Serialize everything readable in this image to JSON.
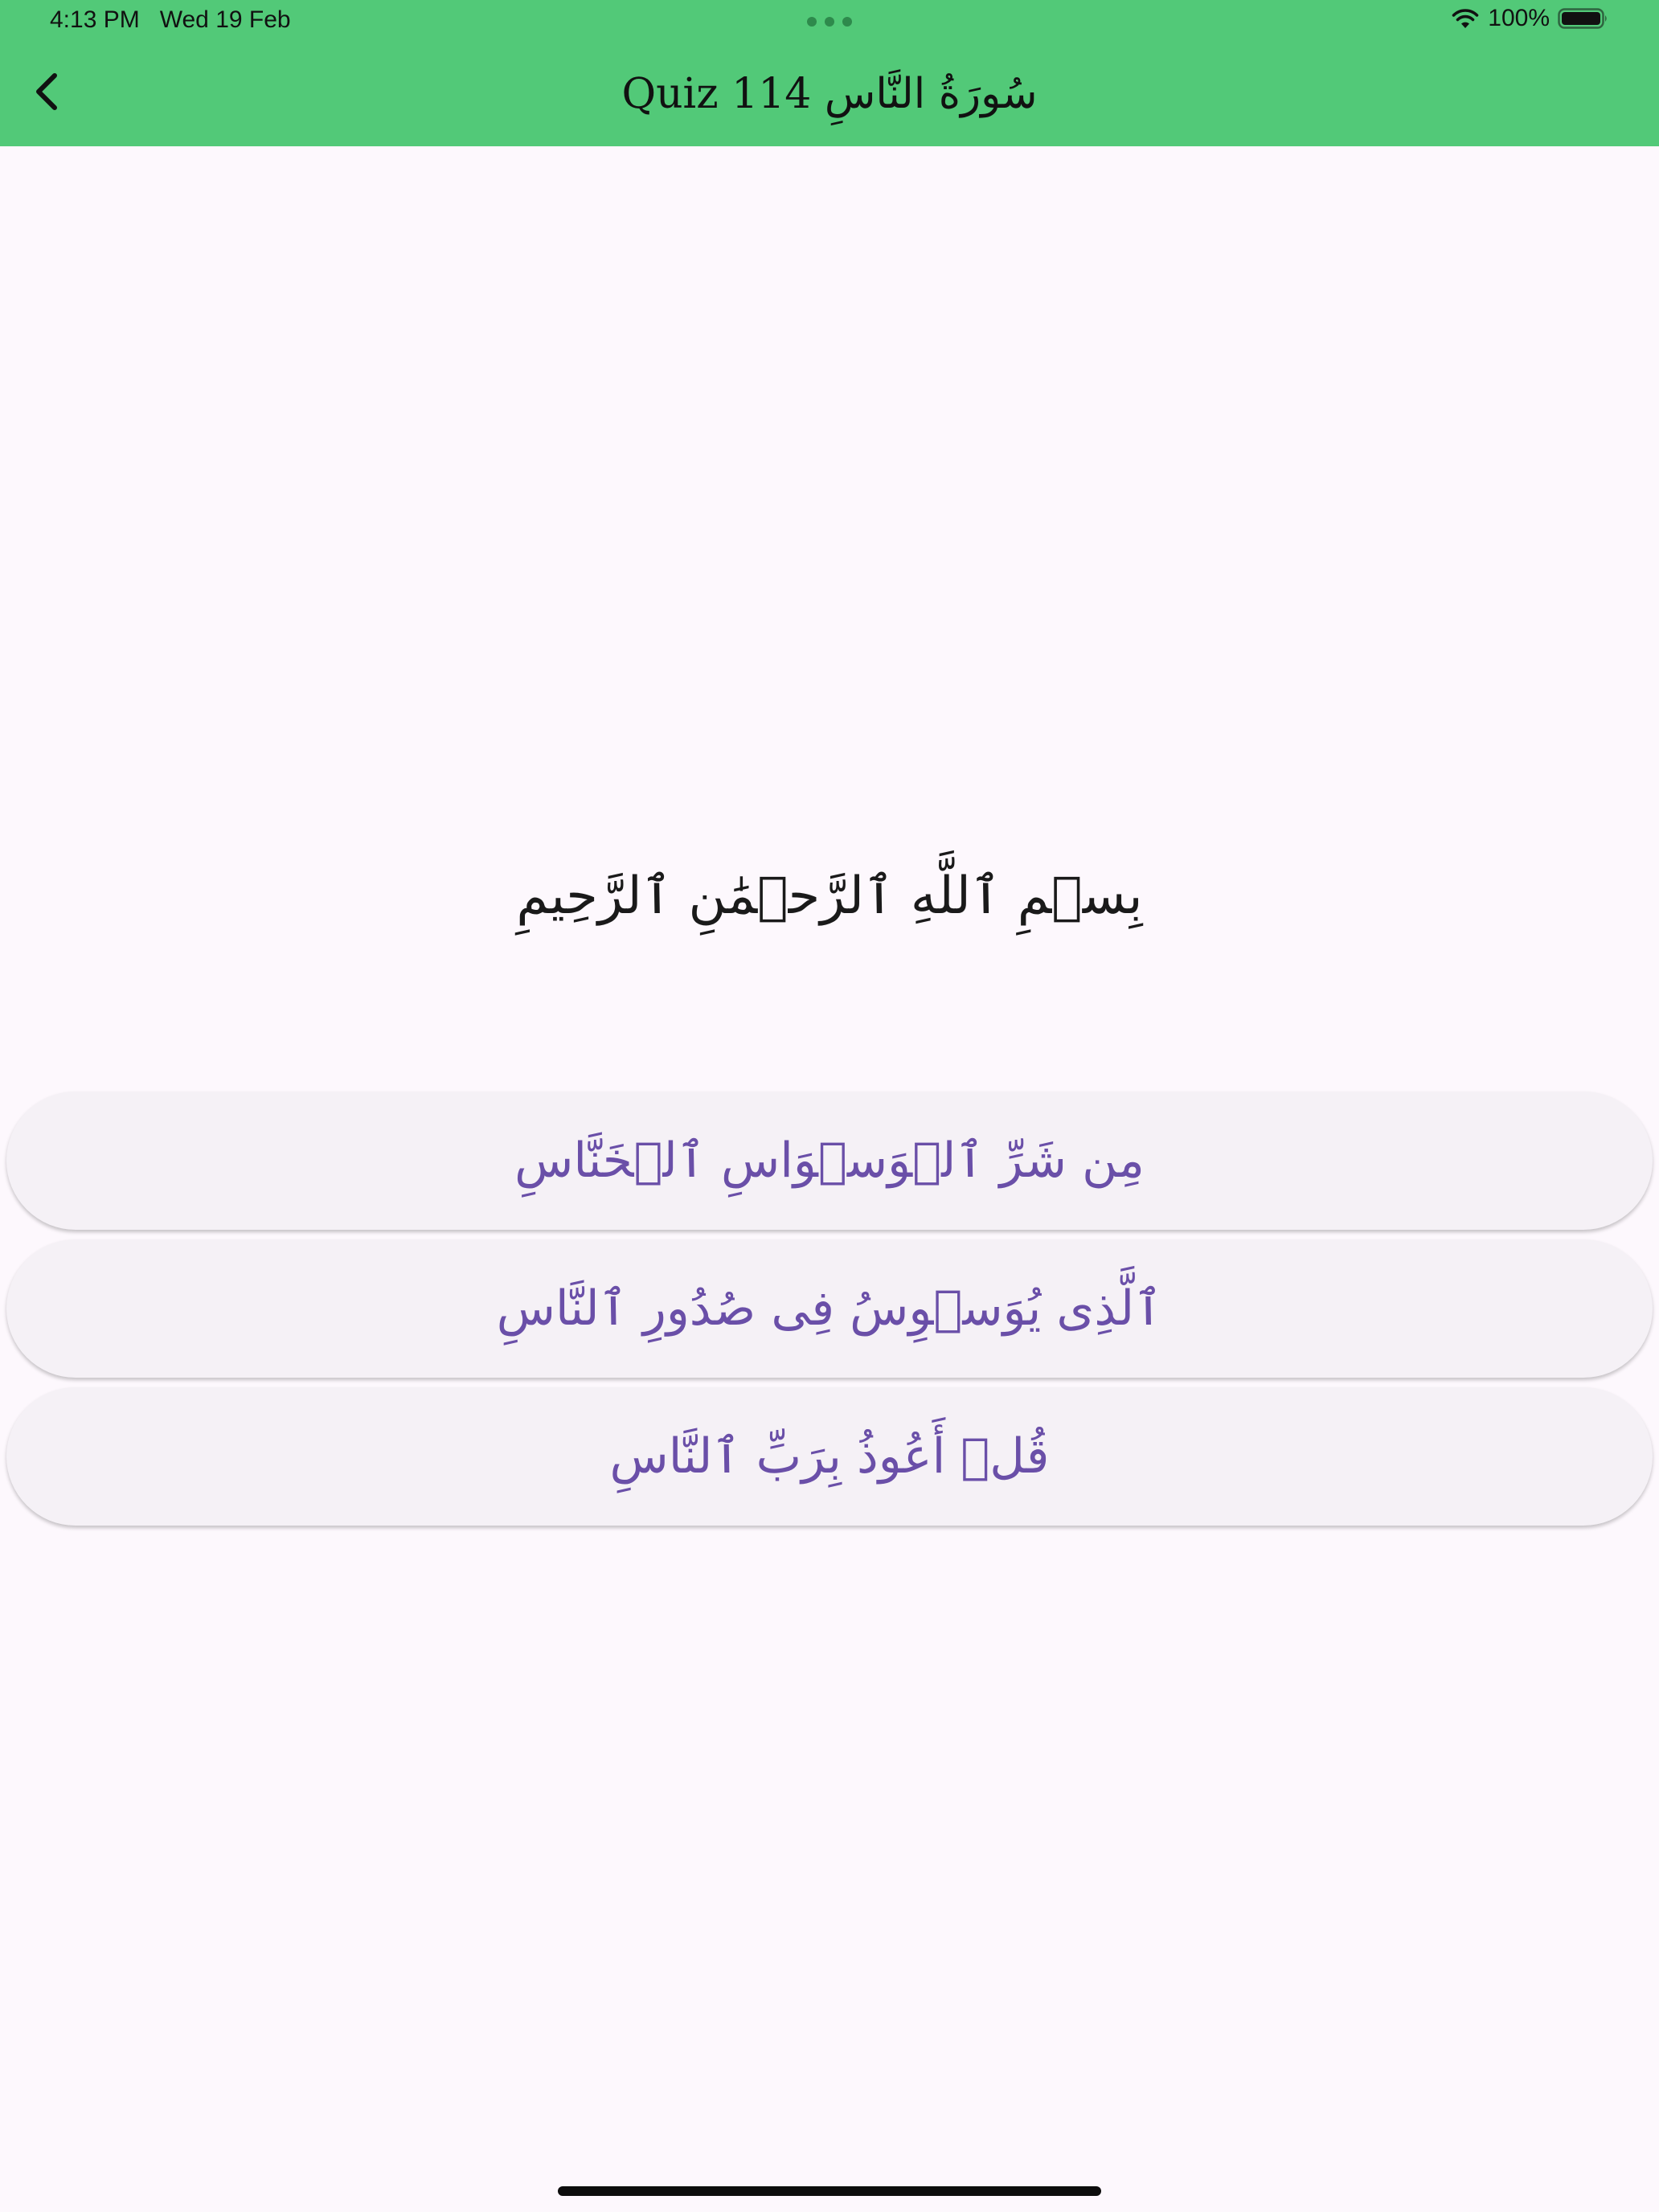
{
  "status_bar": {
    "time": "4:13 PM   Wed 19 Feb",
    "battery": "100%"
  },
  "header": {
    "title": "Quiz سُورَةُ النَّاسِ 114",
    "background": "#52c978"
  },
  "question": {
    "text": "بِسۡمِ ٱللَّهِ ٱلرَّحۡمَٰنِ ٱلرَّحِيمِ"
  },
  "options": [
    {
      "text": "مِن شَرِّ ٱلۡوَسۡوَاسِ ٱلۡخَنَّاسِ"
    },
    {
      "text": "ٱلَّذِى يُوَسۡوِسُ فِى صُدُورِ ٱلنَّاسِ"
    },
    {
      "text": "قُلۡ أَعُوذُ بِرَبِّ ٱلنَّاسِ"
    }
  ],
  "icons": {
    "back": "chevron-left-icon",
    "wifi": "wifi-icon",
    "battery": "battery-icon",
    "multitasking": "more-dots-icon"
  },
  "colors": {
    "accent": "#52c978",
    "option_text": "#6a4fa8",
    "option_background": "#f5f1f6",
    "page_background": "#fdf8fd"
  }
}
